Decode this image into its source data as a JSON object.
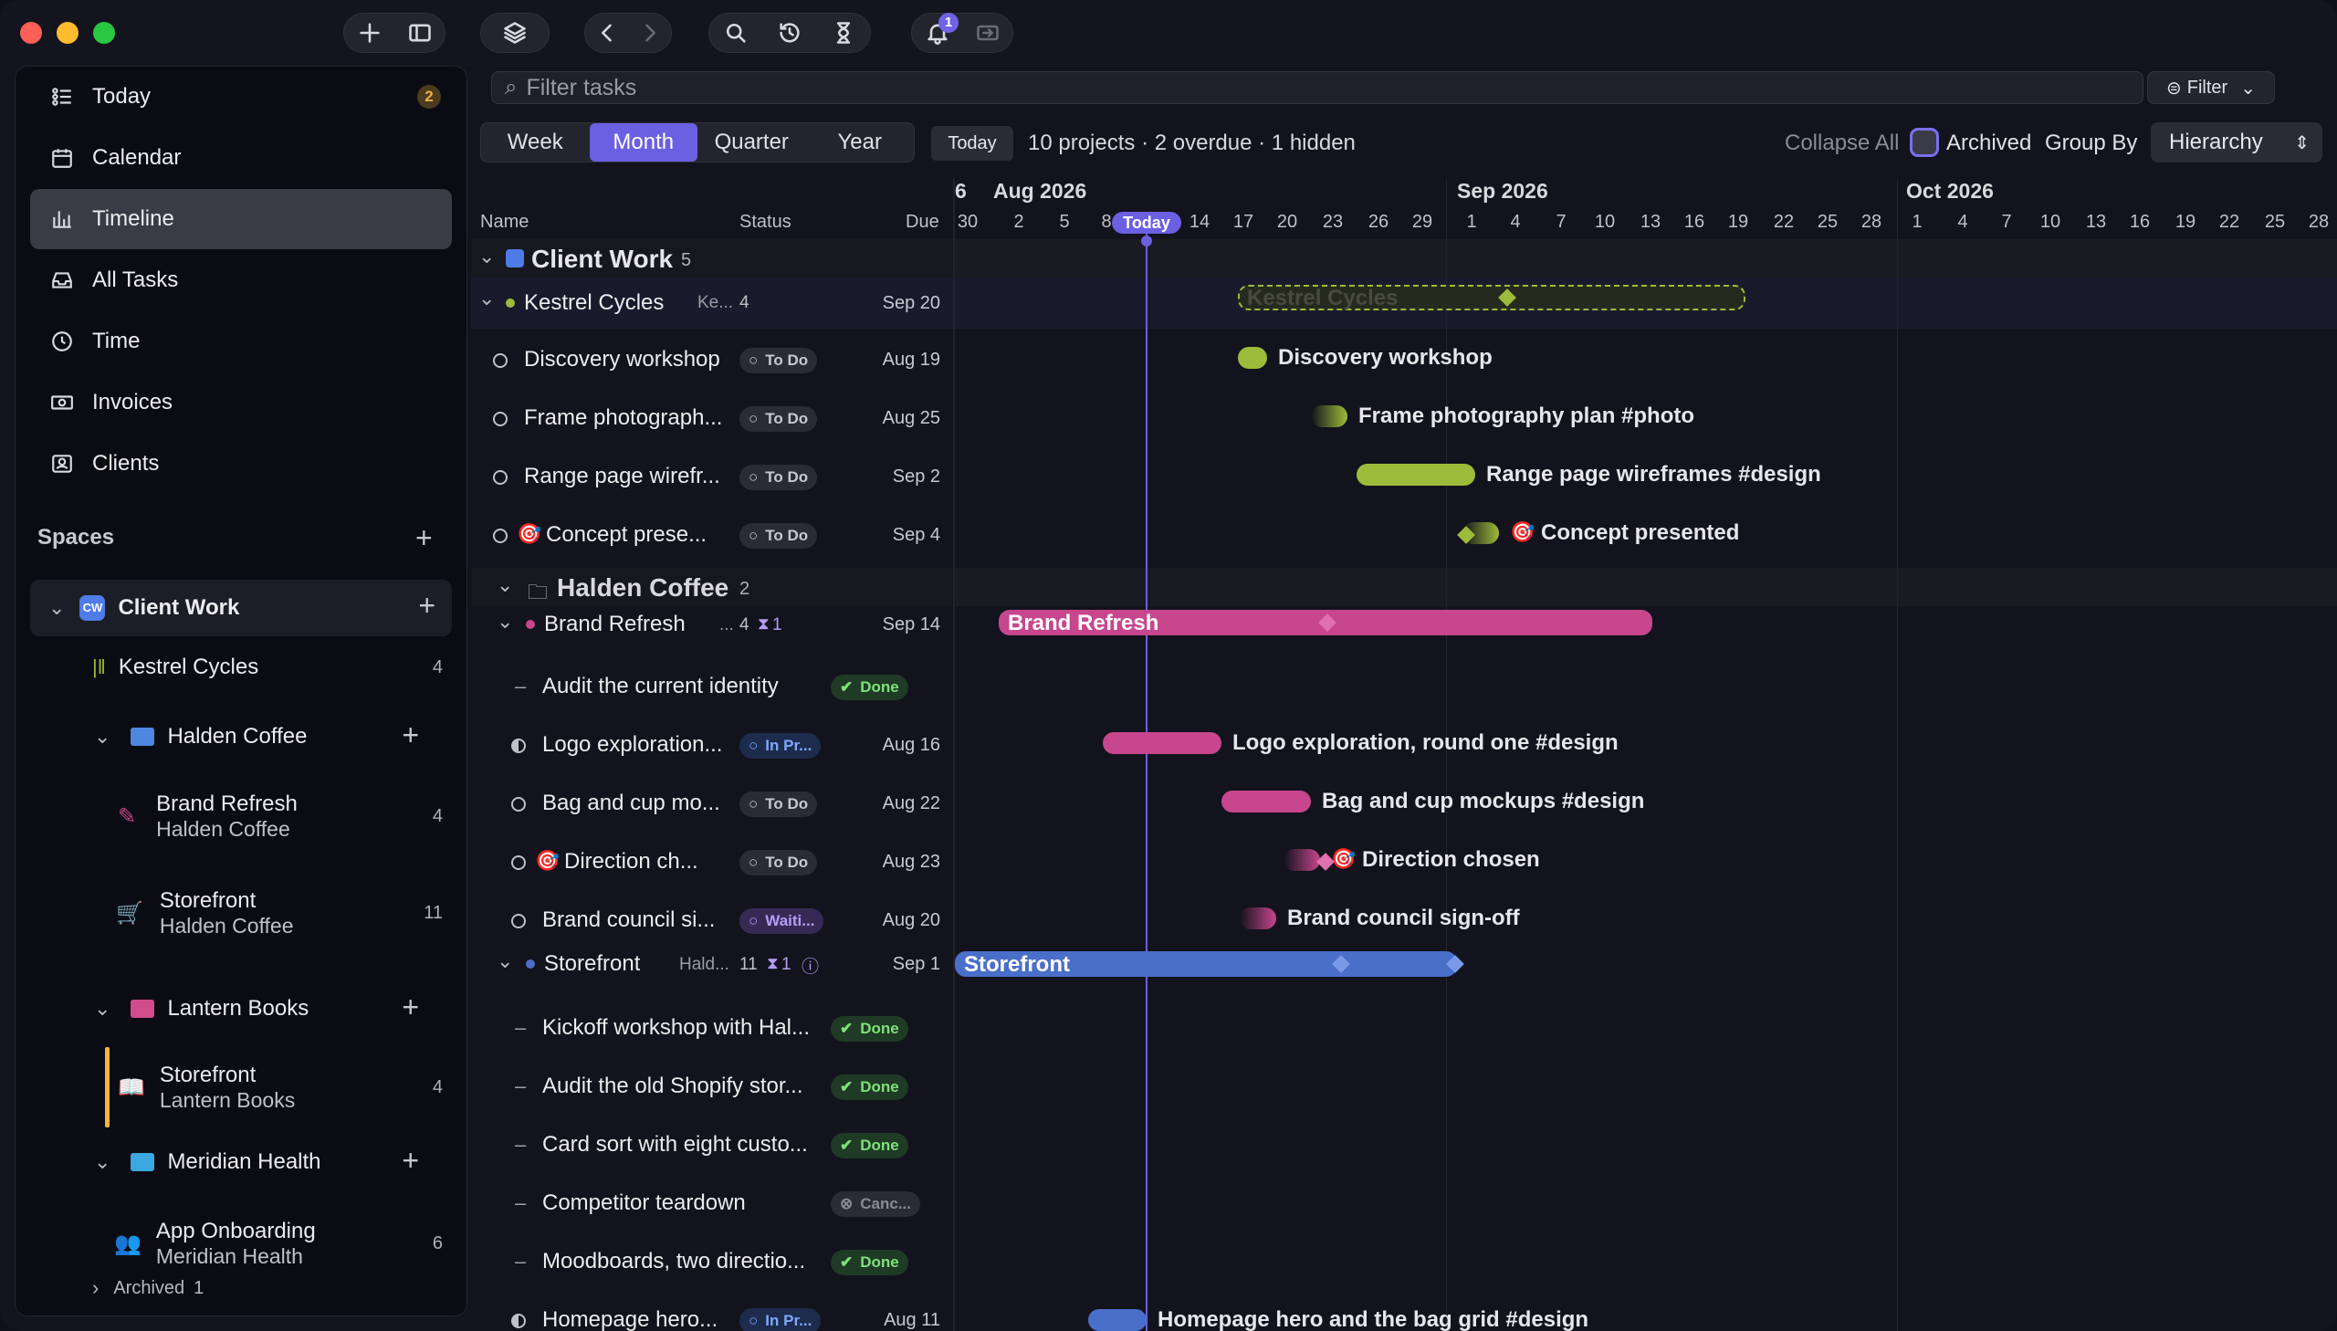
{
  "notifications": {
    "count": "1"
  },
  "sidebar": {
    "nav": [
      {
        "label": "Today",
        "badge": "2"
      },
      {
        "label": "Calendar"
      },
      {
        "label": "Timeline"
      },
      {
        "label": "All Tasks"
      },
      {
        "label": "Time"
      },
      {
        "label": "Invoices"
      },
      {
        "label": "Clients"
      }
    ],
    "spaces_title": "Spaces",
    "spaces": {
      "client_work": {
        "badge": "CW",
        "label": "Client Work"
      },
      "kestrel": {
        "label": "Kestrel Cycles",
        "count": "4"
      },
      "halden": {
        "label": "Halden Coffee"
      },
      "brand_refresh": {
        "label": "Brand Refresh",
        "sub": "Halden Coffee",
        "count": "4"
      },
      "storefront_halden": {
        "label": "Storefront",
        "sub": "Halden Coffee",
        "count": "11"
      },
      "lantern": {
        "label": "Lantern Books"
      },
      "storefront_lantern": {
        "label": "Storefront",
        "sub": "Lantern Books",
        "count": "4"
      },
      "meridian": {
        "label": "Meridian Health"
      },
      "app_onboarding": {
        "label": "App Onboarding",
        "sub": "Meridian Health",
        "count": "6"
      },
      "archived": {
        "label": "Archived",
        "count": "1"
      }
    }
  },
  "filter": {
    "placeholder": "Filter tasks",
    "button": "Filter"
  },
  "view": {
    "modes": [
      "Week",
      "Month",
      "Quarter",
      "Year"
    ],
    "active_mode": "Month",
    "today_button": "Today",
    "summary": "10 projects · 2 overdue · 1 hidden",
    "collapse_all": "Collapse All",
    "archived": "Archived",
    "group_by": "Group By",
    "group_by_value": "Hierarchy"
  },
  "columns": {
    "name": "Name",
    "status": "Status",
    "due": "Due"
  },
  "groups": {
    "client_work": {
      "label": "Client Work",
      "count": "5"
    },
    "halden_coffee": {
      "label": "Halden Coffee",
      "count": "2"
    }
  },
  "projects": {
    "kestrel": {
      "label": "Kestrel Cycles",
      "client": "Ke...",
      "count": "4",
      "due": "Sep 20"
    },
    "brand_refresh": {
      "label": "Brand Refresh",
      "client": "...",
      "count": "4",
      "waiting": "1",
      "due": "Sep 14"
    },
    "storefront": {
      "label": "Storefront",
      "client": "Hald...",
      "count": "11",
      "waiting": "1",
      "due": "Sep 1"
    }
  },
  "tasks": [
    {
      "name": "Discovery workshop",
      "status": "To Do",
      "due": "Aug 19"
    },
    {
      "name": "Frame photograph...",
      "status": "To Do",
      "due": "Aug 25"
    },
    {
      "name": "Range page wirefr...",
      "status": "To Do",
      "due": "Sep 2"
    },
    {
      "name": "Concept prese...",
      "status": "To Do",
      "due": "Sep 4"
    },
    {
      "name": "Audit the current identity",
      "status": "Done",
      "due": ""
    },
    {
      "name": "Logo exploration...",
      "status": "In Pr...",
      "due": "Aug 16"
    },
    {
      "name": "Bag and cup mo...",
      "status": "To Do",
      "due": "Aug 22"
    },
    {
      "name": "Direction ch...",
      "status": "To Do",
      "due": "Aug 23"
    },
    {
      "name": "Brand council si...",
      "status": "Waiti...",
      "due": "Aug 20"
    },
    {
      "name": "Kickoff workshop with Hal...",
      "status": "Done",
      "due": ""
    },
    {
      "name": "Audit the old Shopify stor...",
      "status": "Done",
      "due": ""
    },
    {
      "name": "Card sort with eight custo...",
      "status": "Done",
      "due": ""
    },
    {
      "name": "Competitor teardown",
      "status": "Canc...",
      "due": ""
    },
    {
      "name": "Moodboards, two directio...",
      "status": "Done",
      "due": ""
    },
    {
      "name": "Homepage hero...",
      "status": "In Pr...",
      "due": "Aug 11"
    }
  ],
  "timeline": {
    "months": [
      "Aug 2026",
      "Sep 2026",
      "Oct 2026"
    ],
    "month_prefix": "6",
    "today_label": "Today",
    "days": [
      "30",
      "2",
      "5",
      "8",
      "14",
      "17",
      "20",
      "23",
      "26",
      "29",
      "1",
      "4",
      "7",
      "10",
      "13",
      "16",
      "19",
      "22",
      "25",
      "28",
      "1",
      "4",
      "7",
      "10",
      "13",
      "16",
      "19",
      "22",
      "25",
      "28"
    ],
    "bars": {
      "kestrel": "Kestrel Cycles",
      "discovery": "Discovery workshop",
      "frame": "Frame photography plan #photo",
      "range": "Range page wireframes #design",
      "concept": "Concept presented",
      "brand_refresh": "Brand Refresh",
      "logo": "Logo exploration, round one #design",
      "bag": "Bag and cup mockups #design",
      "direction": "Direction chosen",
      "council": "Brand council sign-off",
      "storefront": "Storefront",
      "homepage": "Homepage hero and the bag grid #design"
    }
  },
  "colors": {
    "accent": "#6b5fe2",
    "kestrel": "#9dbb3a",
    "brand": "#c7468e",
    "storefront": "#4a6fc9"
  }
}
